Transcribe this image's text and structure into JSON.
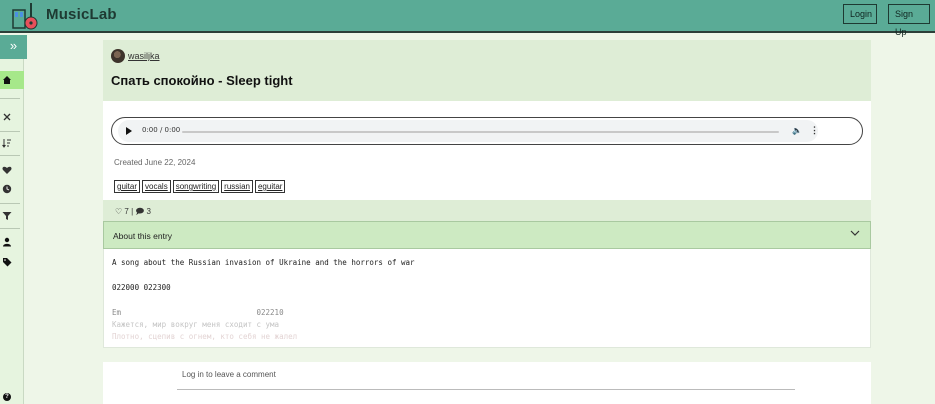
{
  "header": {
    "brand": "MusicLab",
    "login_label": "Login",
    "signup_label": "Sign Up"
  },
  "sidebar": {
    "toggle_glyph": "»",
    "icons": [
      "home-icon",
      "close-icon",
      "sort-icon",
      "heart-icon",
      "clock-icon",
      "filter-icon",
      "user-icon",
      "tag-icon",
      "help-icon"
    ]
  },
  "entry": {
    "username": "wasiljka",
    "title": "Спать спокойно - Sleep tight",
    "audio_time": "0:00 / 0:00",
    "created": "Created June 22, 2024",
    "tags": [
      "guitar",
      "vocals",
      "songwriting",
      "russian",
      "eguitar"
    ],
    "stats": "♡ 7 | 🗩 3",
    "about_label": "About this entry",
    "description": [
      "A song about the Russian invasion of Ukraine and the horrors of war",
      "022000 022300",
      "Em                              022210",
      "Кажется, мир вокруг меня сходит с ума",
      "Плотно, сцепив с огнем, кто себя не жалел"
    ]
  },
  "comments": {
    "login_prompt": "Log in to leave a comment"
  },
  "colors": {
    "topbar": "#5aab96",
    "sidebar_active": "#a6e88a",
    "card_header": "#deedd6",
    "about_bar": "#cdeac2"
  }
}
